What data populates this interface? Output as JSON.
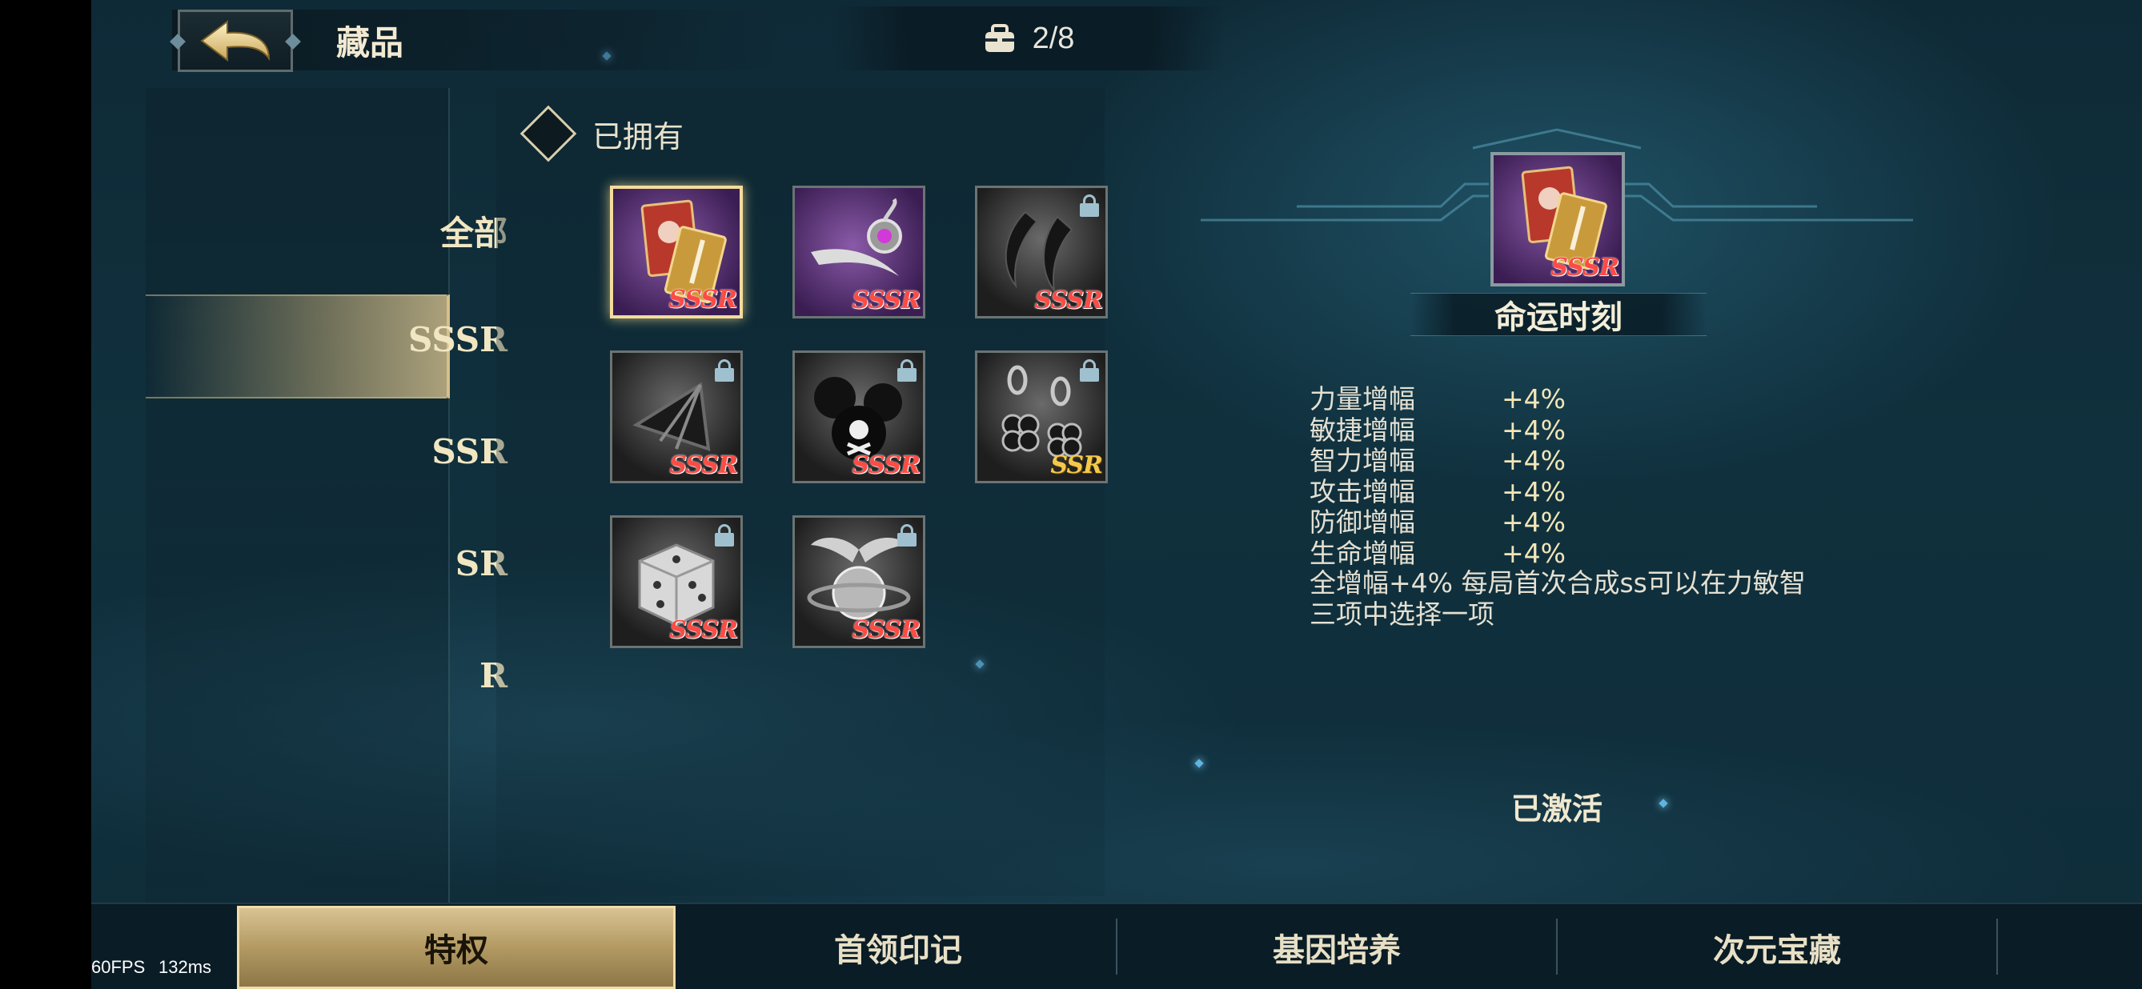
{
  "header": {
    "title": "藏品",
    "counter": "2/8"
  },
  "categories": [
    {
      "label": "全部"
    },
    {
      "label": "SSSR"
    },
    {
      "label": "SSR"
    },
    {
      "label": "SR"
    },
    {
      "label": "R"
    }
  ],
  "selected_category": "SSSR",
  "filter": {
    "owned_label": "已拥有"
  },
  "items": [
    {
      "icon": "fate-cards-icon",
      "rarity": "SSSR",
      "locked": false,
      "selected": true
    },
    {
      "icon": "ornate-scythe-icon",
      "rarity": "SSSR",
      "locked": false,
      "selected": false
    },
    {
      "icon": "black-claws-icon",
      "rarity": "SSSR",
      "locked": true,
      "selected": false
    },
    {
      "icon": "bone-wing-icon",
      "rarity": "SSSR",
      "locked": true,
      "selected": false
    },
    {
      "icon": "skull-bombs-icon",
      "rarity": "SSSR",
      "locked": true,
      "selected": false
    },
    {
      "icon": "clover-earrings-icon",
      "rarity": "SSR",
      "locked": true,
      "selected": false
    },
    {
      "icon": "dice-icon",
      "rarity": "SSSR",
      "locked": true,
      "selected": false
    },
    {
      "icon": "winged-orb-icon",
      "rarity": "SSSR",
      "locked": true,
      "selected": false
    }
  ],
  "detail": {
    "name": "命运时刻",
    "rarity": "SSSR",
    "stats": [
      {
        "name": "力量增幅",
        "value": "+4%"
      },
      {
        "name": "敏捷增幅",
        "value": "+4%"
      },
      {
        "name": "智力增幅",
        "value": "+4%"
      },
      {
        "name": "攻击增幅",
        "value": "+4%"
      },
      {
        "name": "防御增幅",
        "value": "+4%"
      },
      {
        "name": "生命增幅",
        "value": "+4%"
      }
    ],
    "description": "全增幅+4% 每局首次合成ss可以在力敏智三项中选择一项",
    "status": "已激活"
  },
  "tabs": [
    {
      "label": "特权",
      "active": true
    },
    {
      "label": "首领印记",
      "active": false
    },
    {
      "label": "基因培养",
      "active": false
    },
    {
      "label": "次元宝藏",
      "active": false
    }
  ],
  "overlay": {
    "fps": "60FPS",
    "latency": "132ms"
  },
  "colors": {
    "sssr": "#ff4b45",
    "ssr": "#f3c94a",
    "accent_gold": "#d6c08a"
  }
}
